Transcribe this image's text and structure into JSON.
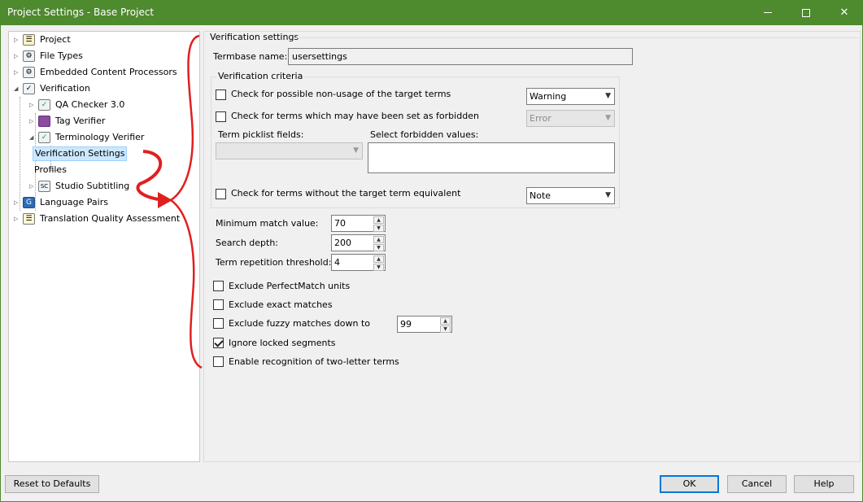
{
  "window": {
    "title": "Project Settings - Base Project",
    "min_glyph": "",
    "max_glyph": "",
    "close_glyph": "✕"
  },
  "tree": {
    "items": [
      {
        "label": "Project",
        "icon": "project-icon"
      },
      {
        "label": "File Types",
        "icon": "file-types-icon"
      },
      {
        "label": "Embedded Content Processors",
        "icon": "embedded-content-icon"
      },
      {
        "label": "Verification",
        "icon": "verification-icon"
      },
      {
        "label": "QA Checker 3.0",
        "icon": "qa-checker-icon"
      },
      {
        "label": "Tag Verifier",
        "icon": "tag-verifier-icon"
      },
      {
        "label": "Terminology Verifier",
        "icon": "terminology-verifier-icon"
      },
      {
        "label": "Verification Settings",
        "icon": ""
      },
      {
        "label": "Profiles",
        "icon": ""
      },
      {
        "label": "Studio Subtitling",
        "icon": "studio-subtitling-icon"
      },
      {
        "label": "Language Pairs",
        "icon": "language-pairs-icon"
      },
      {
        "label": "Translation Quality Assessment",
        "icon": "tqa-icon"
      }
    ],
    "selected": "Verification Settings"
  },
  "settings": {
    "group_title": "Verification settings",
    "termbase_label": "Termbase name:",
    "termbase_value": "usersettings",
    "criteria_title": "Verification criteria",
    "check_nonusage": {
      "label": "Check for possible non-usage of the target terms",
      "checked": false
    },
    "nonusage_level": "Warning",
    "check_forbidden": {
      "label": "Check for terms which may have been set as forbidden",
      "checked": false
    },
    "forbidden_level": "Error",
    "picklist_label": "Term picklist fields:",
    "picklist_value": "",
    "forbidden_values_label": "Select forbidden values:",
    "check_no_equivalent": {
      "label": "Check for terms without the target term equivalent",
      "checked": false
    },
    "no_equivalent_level": "Note",
    "min_match_label": "Minimum match value:",
    "min_match_value": "70",
    "search_depth_label": "Search depth:",
    "search_depth_value": "200",
    "repetition_label": "Term repetition threshold:",
    "repetition_value": "4",
    "exclude_perfectmatch": {
      "label": "Exclude PerfectMatch units",
      "checked": false
    },
    "exclude_exact": {
      "label": "Exclude exact matches",
      "checked": false
    },
    "exclude_fuzzy": {
      "label": "Exclude fuzzy matches down to",
      "checked": false
    },
    "fuzzy_value": "99",
    "ignore_locked": {
      "label": "Ignore locked segments",
      "checked": true
    },
    "two_letter": {
      "label": "Enable recognition of two-letter terms",
      "checked": false
    }
  },
  "footer": {
    "reset_label": "Reset to Defaults",
    "ok_label": "OK",
    "cancel_label": "Cancel",
    "help_label": "Help"
  },
  "annotation_color": "#e02020"
}
